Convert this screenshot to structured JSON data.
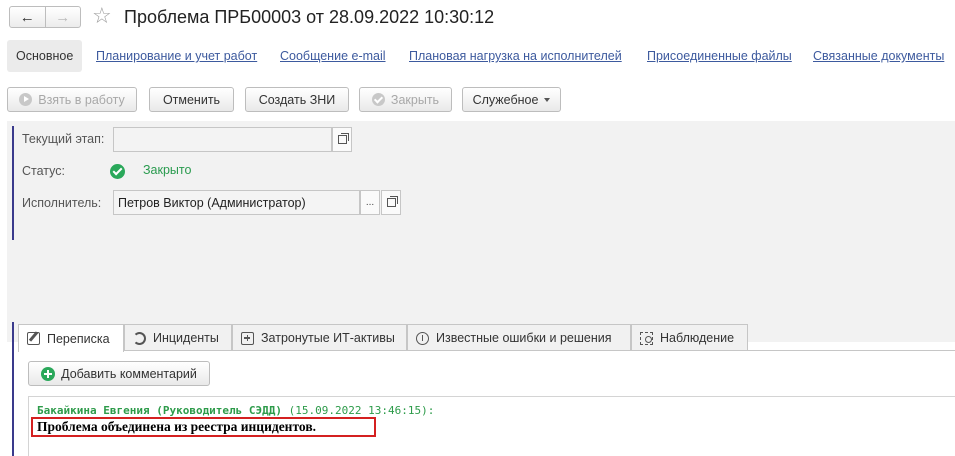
{
  "window": {
    "title": "Проблема ПРБ00003 от 28.09.2022 10:30:12",
    "nav_back_glyph": "←",
    "nav_forward_glyph": "→",
    "favorite_glyph": "☆"
  },
  "tabs": {
    "main": "Основное",
    "links": [
      "Планирование и учет работ",
      "Сообщение e-mail",
      "Плановая нагрузка на исполнителей",
      "Присоединенные файлы",
      "Связанные документы"
    ]
  },
  "toolbar": {
    "take_to_work": "Взять в работу",
    "cancel": "Отменить",
    "create_zni": "Создать ЗНИ",
    "close": "Закрыть",
    "service": "Служебное"
  },
  "form": {
    "stage_label": "Текущий этап:",
    "stage_value": "",
    "status_label": "Статус:",
    "status_value": "Закрыто",
    "assignee_label": "Исполнитель:",
    "assignee_value": "Петров Виктор (Администратор)",
    "select_glyph": "..."
  },
  "bottom_tabs": [
    "Переписка",
    "Инциденты",
    "Затронутые ИТ-активы",
    "Известные ошибки и решения",
    "Наблюдение"
  ],
  "comments": {
    "add_button": "Добавить комментарий",
    "author": "Бакайкина Евгения (Руководитель СЭДД)",
    "date": "(15.09.2022 13:46:15):",
    "text": "Проблема объединена из реестра инцидентов."
  },
  "colors": {
    "link": "#3d5a9e",
    "status_green": "#2aa85a",
    "highlight_red": "#d42020",
    "accent_bar": "#3a3a8c"
  }
}
